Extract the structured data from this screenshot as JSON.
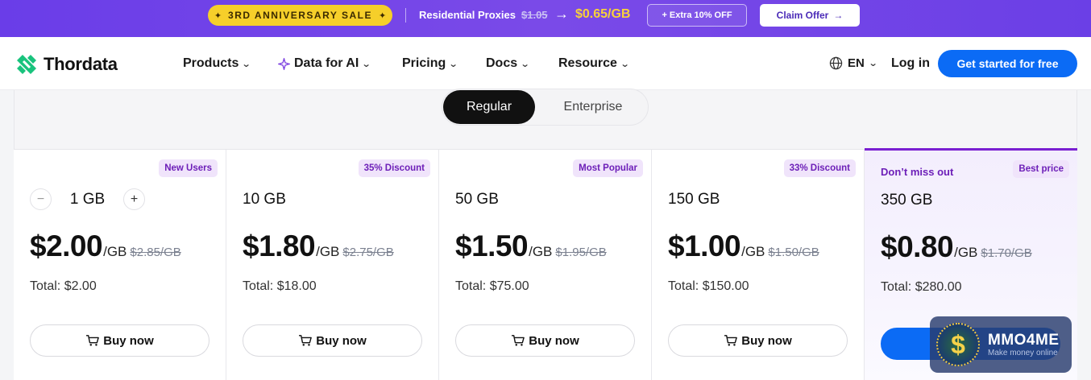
{
  "promo": {
    "sale_label": "3RD ANNIVERSARY SALE",
    "product": "Residential Proxies",
    "old_price": "$1.05",
    "new_price": "$0.65/GB",
    "extra": "+ Extra 10% OFF",
    "claim": "Claim Offer"
  },
  "nav": {
    "brand": "Thordata",
    "items": [
      "Products",
      "Data for AI",
      "Pricing",
      "Docs",
      "Resource"
    ],
    "language": "EN",
    "login": "Log in",
    "cta": "Get started for free"
  },
  "toggle": {
    "options": [
      "Regular",
      "Enterprise"
    ],
    "active": "Regular"
  },
  "plans": [
    {
      "badge": "New Users",
      "gb": "1 GB",
      "price": "$2.00",
      "unit": "/GB",
      "old": "$2.85/GB",
      "total": "Total: $2.00",
      "buy": "Buy now",
      "stepper": true,
      "minus": "−",
      "plus": "+"
    },
    {
      "badge": "35% Discount",
      "gb": "10 GB",
      "price": "$1.80",
      "unit": "/GB",
      "old": "$2.75/GB",
      "total": "Total: $18.00",
      "buy": "Buy now"
    },
    {
      "badge": "Most Popular",
      "gb": "50 GB",
      "price": "$1.50",
      "unit": "/GB",
      "old": "$1.95/GB",
      "total": "Total: $75.00",
      "buy": "Buy now"
    },
    {
      "badge": "33% Discount",
      "gb": "150 GB",
      "price": "$1.00",
      "unit": "/GB",
      "old": "$1.50/GB",
      "total": "Total: $150.00",
      "buy": "Buy now"
    },
    {
      "badge": "Best price",
      "tag": "Don’t miss out",
      "gb": "350 GB",
      "price": "$0.80",
      "unit": "/GB",
      "old": "$1.70/GB",
      "total": "Total: $280.00",
      "buy": "",
      "featured": true
    }
  ],
  "watermark": {
    "title": "MMO4ME",
    "subtitle": "Make money online",
    "symbol": "$"
  },
  "colors": {
    "primary": "#0b6bf5",
    "promo_bg": "#6a3de8",
    "sale_yellow": "#f6cf2a",
    "badge_purple": "#6d1fb8"
  }
}
